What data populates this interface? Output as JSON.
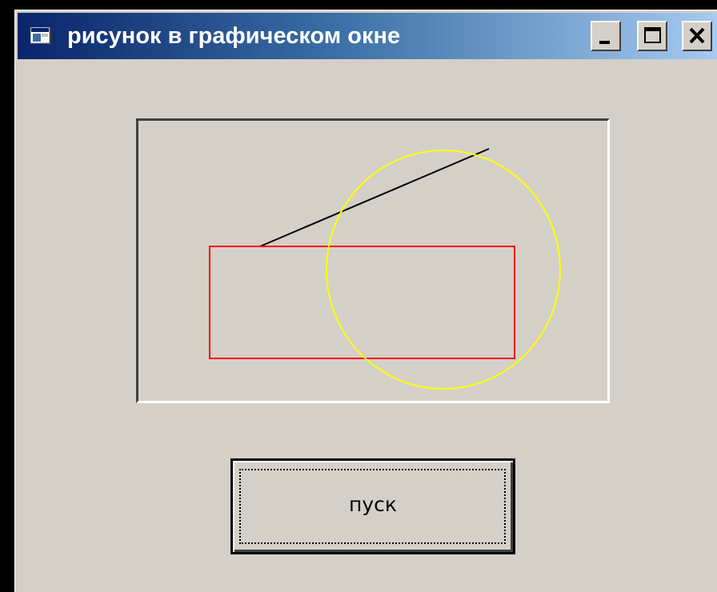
{
  "window": {
    "title": "рисунок в графическом окне",
    "minimize_icon": "minimize-icon",
    "maximize_icon": "maximize-icon",
    "close_icon": "close-icon",
    "app_icon": "form-icon"
  },
  "picture": {
    "line_color": "#000000",
    "rectangle_color": "#ff0000",
    "circle_color": "#ffff00"
  },
  "start_button": {
    "label": "пуск"
  }
}
